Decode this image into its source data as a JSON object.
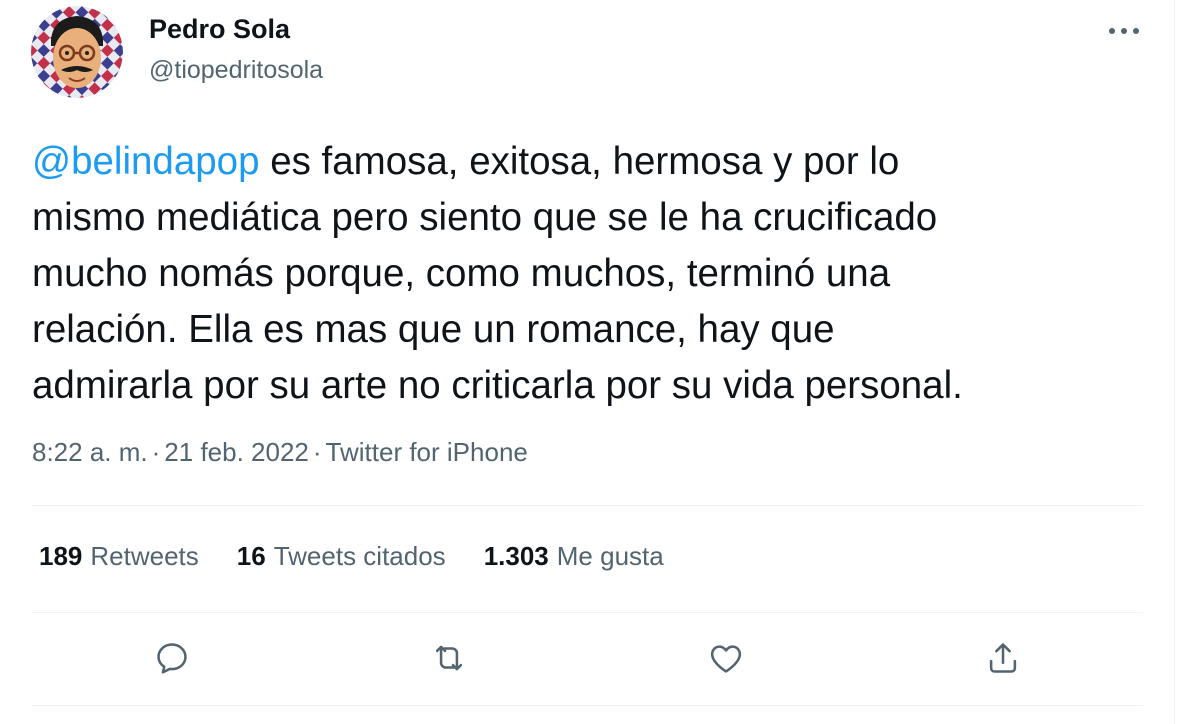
{
  "user": {
    "display_name": "Pedro Sola",
    "handle": "@tiopedritosola",
    "avatar_icon": "caricature-avatar"
  },
  "tweet": {
    "mention": "@belindapop",
    "lines": [
      " es famosa, exitosa, hermosa y por lo",
      "mismo mediática pero siento que se le ha crucificado",
      "mucho nomás porque, como muchos, terminó una",
      "relación. Ella es mas que un romance, hay que",
      "admirarla por su arte no criticarla por su vida personal."
    ]
  },
  "meta": {
    "time": "8:22 a. m.",
    "date": "21 feb. 2022",
    "source": "Twitter for iPhone",
    "separator": "·"
  },
  "stats": {
    "retweets": {
      "count": "189",
      "label": "Retweets"
    },
    "quotes": {
      "count": "16",
      "label": "Tweets citados"
    },
    "likes": {
      "count": "1.303",
      "label": "Me gusta"
    }
  },
  "actions": {
    "reply_icon": "reply-icon",
    "retweet_icon": "retweet-icon",
    "like_icon": "like-icon",
    "share_icon": "share-icon"
  },
  "colors": {
    "accent": "#1d9bf0",
    "text": "#0f1419",
    "secondary": "#536471",
    "divider": "#eff3f4"
  }
}
